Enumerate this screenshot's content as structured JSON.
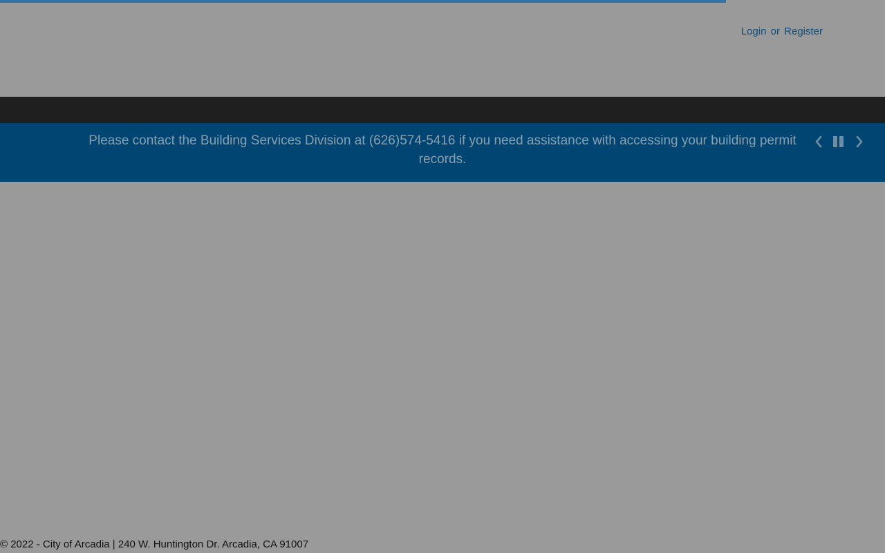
{
  "auth": {
    "login_label": "Login",
    "separator": "or",
    "register_label": "Register"
  },
  "announcement": {
    "text": "Please contact the Building Services Division at (626)574-5416 if you need assistance with accessing your building permit records."
  },
  "carousel_controls": {
    "prev_icon": "chevron-left-icon",
    "pause_icon": "pause-icon",
    "next_icon": "chevron-right-icon"
  },
  "footer": {
    "text": "© 2022 - City of Arcadia | 240 W. Huntington Dr. Arcadia, CA 91007"
  },
  "colors": {
    "overlay_bg": "#9a9a9a",
    "nav_bar": "#1f1f1f",
    "announcement_bg": "#014673",
    "link": "#0f4e7a",
    "progress": "#2f73a8"
  }
}
